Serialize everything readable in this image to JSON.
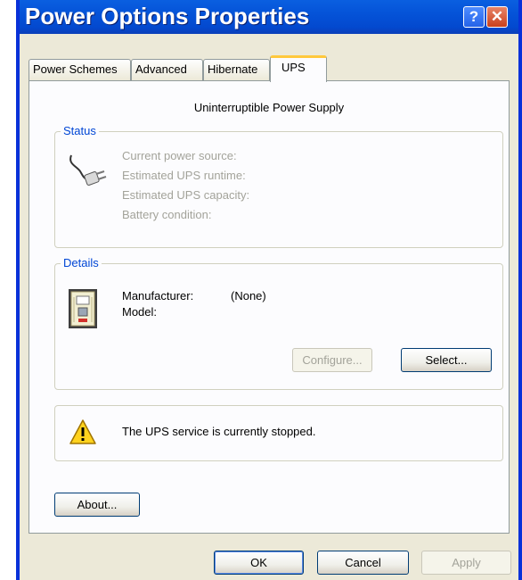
{
  "window": {
    "title": "Power Options Properties"
  },
  "title_buttons": {
    "help": "?",
    "close": "✕"
  },
  "tabs": [
    {
      "label": "Power Schemes"
    },
    {
      "label": "Advanced"
    },
    {
      "label": "Hibernate"
    },
    {
      "label": "UPS"
    }
  ],
  "ups": {
    "heading": "Uninterruptible Power Supply",
    "status": {
      "label": "Status",
      "lines": [
        "Current power source:",
        "Estimated UPS runtime:",
        "Estimated UPS capacity:",
        "Battery condition:"
      ]
    },
    "details": {
      "label": "Details",
      "manufacturer_label": "Manufacturer:",
      "manufacturer_value": "(None)",
      "model_label": "Model:",
      "configure_label": "Configure...",
      "select_label": "Select..."
    },
    "message": "The UPS service is currently stopped.",
    "about_label": "About..."
  },
  "footer": {
    "ok": "OK",
    "cancel": "Cancel",
    "apply": "Apply"
  },
  "colors": {
    "titlebar": "#0553d8",
    "group_label": "#0046d5",
    "tab_highlight": "#ffc83c"
  },
  "icons": [
    "help-icon",
    "close-icon",
    "power-plug-icon",
    "ups-device-icon",
    "warning-icon"
  ]
}
